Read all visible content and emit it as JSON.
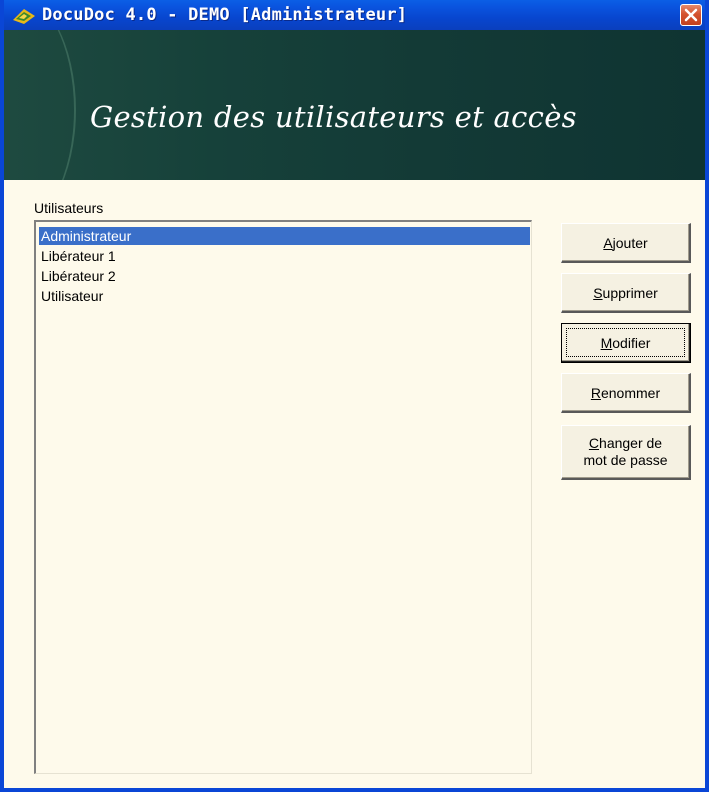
{
  "window": {
    "title": "DocuDoc 4.0 - DEMO [Administrateur]",
    "app_icon": "docudoc-logo-icon",
    "close_icon": "close-icon"
  },
  "banner": {
    "title": "Gestion des utilisateurs et accès"
  },
  "users": {
    "label": "Utilisateurs",
    "items": [
      {
        "label": "Administrateur",
        "selected": true
      },
      {
        "label": "Libérateur 1",
        "selected": false
      },
      {
        "label": "Libérateur 2",
        "selected": false
      },
      {
        "label": "Utilisateur",
        "selected": false
      }
    ]
  },
  "buttons": {
    "add": "Ajouter",
    "delete": "Supprimer",
    "modify": "Modifier",
    "rename": "Renommer",
    "change_password_line1": "Changer de",
    "change_password_line2": "mot de passe"
  },
  "colors": {
    "titlebar": "#0846cf",
    "banner": "#16413a",
    "background": "#fefaeb",
    "selection": "#3a6fc9"
  }
}
